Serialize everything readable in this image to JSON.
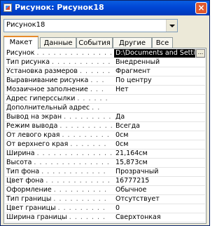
{
  "window": {
    "title": "Рисунок: Рисунок18",
    "close_label": "×"
  },
  "object_selector": {
    "value": "Рисунок18"
  },
  "tabs": [
    {
      "label": "Макет"
    },
    {
      "label": "Данные"
    },
    {
      "label": "События"
    },
    {
      "label": "Другие"
    },
    {
      "label": "Все"
    }
  ],
  "active_tab": "Макет",
  "properties": [
    {
      "name": "Рисунок",
      "value": "D:\\Documents and Settin"
    },
    {
      "name": "Тип рисунка",
      "value": "Внедренный"
    },
    {
      "name": "Установка размеров",
      "value": "Фрагмент"
    },
    {
      "name": "Выравнивание рисунка",
      "value": "По центру"
    },
    {
      "name": "Мозаичное заполнение",
      "value": "Нет"
    },
    {
      "name": "Адрес гиперссылки",
      "value": ""
    },
    {
      "name": "Дополнительный адрес",
      "value": ""
    },
    {
      "name": "Вывод на экран",
      "value": "Да"
    },
    {
      "name": "Режим вывода",
      "value": "Всегда"
    },
    {
      "name": "От левого края",
      "value": "0см"
    },
    {
      "name": "От верхнего края",
      "value": "0см"
    },
    {
      "name": "Ширина",
      "value": "21,164см"
    },
    {
      "name": "Высота",
      "value": "15,873см"
    },
    {
      "name": "Тип фона",
      "value": "Прозрачный"
    },
    {
      "name": "Цвет фона",
      "value": "16777215"
    },
    {
      "name": "Оформление",
      "value": "Обычное"
    },
    {
      "name": "Тип границы",
      "value": "Отсутствует"
    },
    {
      "name": "Цвет границы",
      "value": "0"
    },
    {
      "name": "Ширина границы",
      "value": "Сверхтонкая"
    }
  ],
  "builder_button_label": "...",
  "colors": {
    "titlebar": "#0a5de0",
    "active_tab_accent": "#e68b2c",
    "selection": "#000000"
  }
}
